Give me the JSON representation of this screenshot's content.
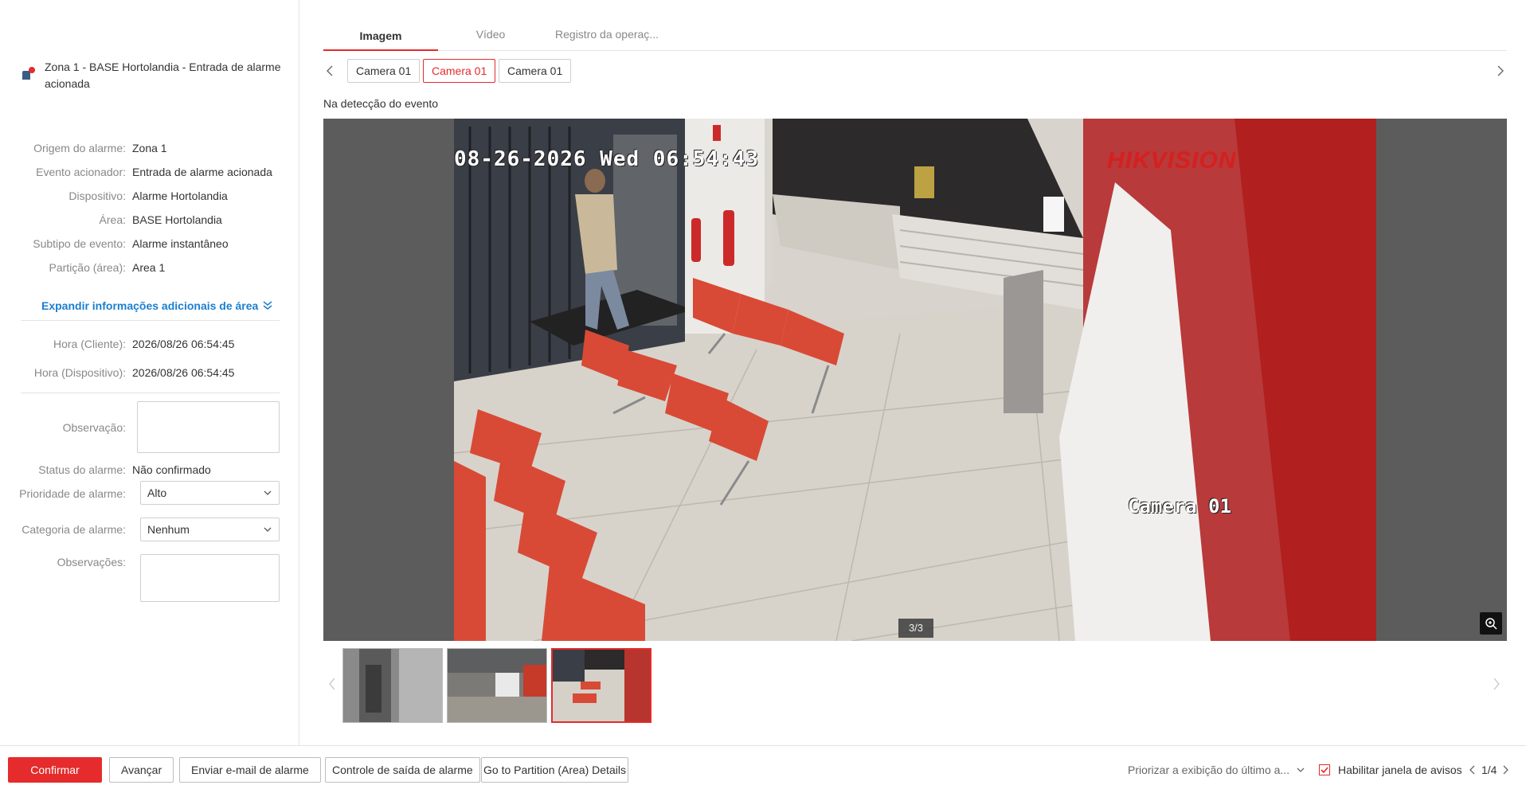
{
  "alarm": {
    "title": "Zona 1 - BASE Hortolandia - Entrada de alarme acionada"
  },
  "info": [
    {
      "label": "Origem do alarme:",
      "value": "Zona 1"
    },
    {
      "label": "Evento acionador:",
      "value": "Entrada de alarme acionada"
    },
    {
      "label": "Dispositivo:",
      "value": "Alarme Hortolandia"
    },
    {
      "label": "Área:",
      "value": "BASE Hortolandia"
    },
    {
      "label": "Subtipo de evento:",
      "value": "Alarme instantâneo"
    },
    {
      "label": "Partição (área):",
      "value": "Area 1"
    }
  ],
  "expand_label": "Expandir informações adicionais de área",
  "times": [
    {
      "label": "Hora (Cliente):",
      "value": "2026/08/26 06:54:45"
    },
    {
      "label": "Hora (Dispositivo):",
      "value": "2026/08/26 06:54:45"
    }
  ],
  "form": {
    "observacao_label": "Observação:",
    "status_label": "Status do alarme:",
    "status_value": "Não confirmado",
    "prioridade_label": "Prioridade de alarme:",
    "prioridade_value": "Alto",
    "categoria_label": "Categoria de alarme:",
    "categoria_value": "Nenhum",
    "observacoes_label": "Observações:"
  },
  "tabs": [
    "Imagem",
    "Vídeo",
    "Registro da operaç..."
  ],
  "cameras": [
    "Camera 01",
    "Camera 01",
    "Camera 01"
  ],
  "event_label": "Na detecção do evento",
  "image": {
    "osd_time": "08-26-2026 Wed 06:54:43",
    "osd_camera": "Camera 01",
    "brand": "HIKVISION",
    "counter": "3/3"
  },
  "footer": {
    "confirm": "Confirmar",
    "next": "Avançar",
    "email": "Enviar e-mail de alarme",
    "output": "Controle de saída de alarme",
    "partition": "Go to Partition (Area) Details",
    "priority_display": "Priorizar a exibição do último a...",
    "enable_popup": "Habilitar janela de avisos",
    "page": "1/4"
  },
  "colors": {
    "accent": "#e52b2b",
    "link": "#1b7ed0"
  }
}
